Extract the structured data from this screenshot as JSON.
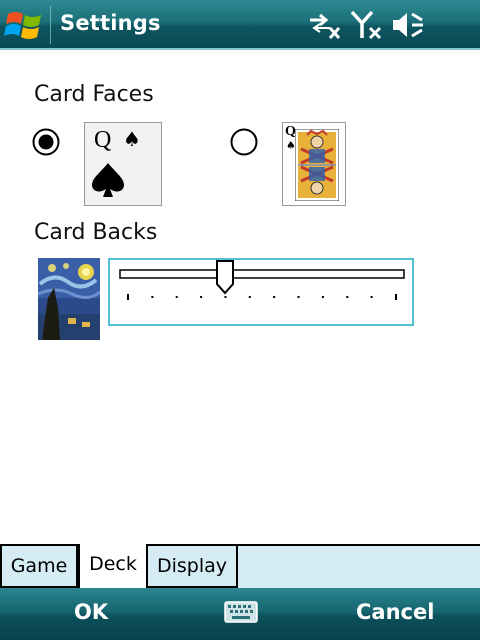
{
  "titlebar": {
    "title": "Settings"
  },
  "status_icons": [
    "connectivity-icon",
    "signal-off-icon",
    "volume-mute-icon"
  ],
  "card_faces": {
    "label": "Card Faces",
    "options": [
      {
        "selected": true,
        "rank": "Q",
        "suit": "♠"
      },
      {
        "selected": false,
        "rank": "Q",
        "suit": "♠"
      }
    ]
  },
  "card_backs": {
    "label": "Card Backs",
    "slider": {
      "ticks": 12,
      "position": 4
    }
  },
  "tabs": [
    {
      "label": "Game",
      "active": false
    },
    {
      "label": "Deck",
      "active": true
    },
    {
      "label": "Display",
      "active": false
    }
  ],
  "softkeys": {
    "left": "OK",
    "right": "Cancel"
  },
  "colors": {
    "accent": "#53c0d6",
    "titlebar": "#1b6f79",
    "tab_bg": "#d5ecf5"
  }
}
